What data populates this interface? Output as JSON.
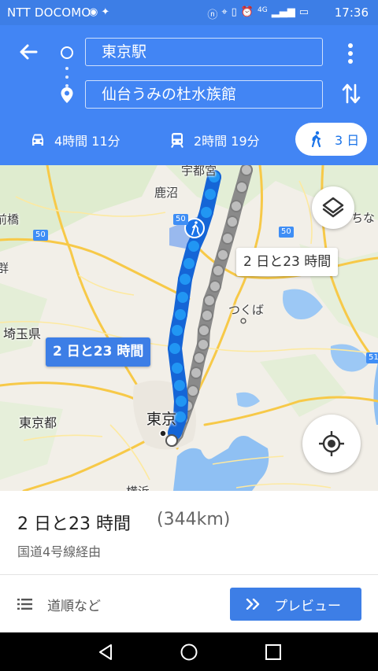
{
  "status_bar": {
    "carrier": "NTT DOCOMO",
    "network": "4G",
    "time": "17:36"
  },
  "search": {
    "origin": "東京駅",
    "destination": "仙台うみの杜水族館"
  },
  "modes": [
    {
      "name": "car",
      "label": "4時間 11分"
    },
    {
      "name": "transit",
      "label": "2時間 19分"
    },
    {
      "name": "walk",
      "label": "3 日",
      "selected": true
    }
  ],
  "map": {
    "labels": {
      "utsunomiya": "宇都宮",
      "kanuma": "鹿沼",
      "maebashi": "前橋",
      "tsukuba": "つくば",
      "saitama": "埼玉県",
      "tokyo_to": "東京都",
      "tokyo": "東京",
      "chiba_right": "ちな",
      "yokohama": "横浜",
      "left_edge": "群"
    },
    "route_shields": [
      "50",
      "50",
      "50",
      "51"
    ],
    "callout_primary": "2 日と23 時間",
    "callout_alt": "2 日と23 時間",
    "colors": {
      "route_active": "#1a73e8",
      "route_alt": "#a8a8a8",
      "accent": "#4285f4"
    }
  },
  "summary": {
    "duration": "2 日と23 時間",
    "distance": "(344km)",
    "via": "国道4号線経由",
    "steps_label": "道順など",
    "preview_label": "プレビュー"
  }
}
